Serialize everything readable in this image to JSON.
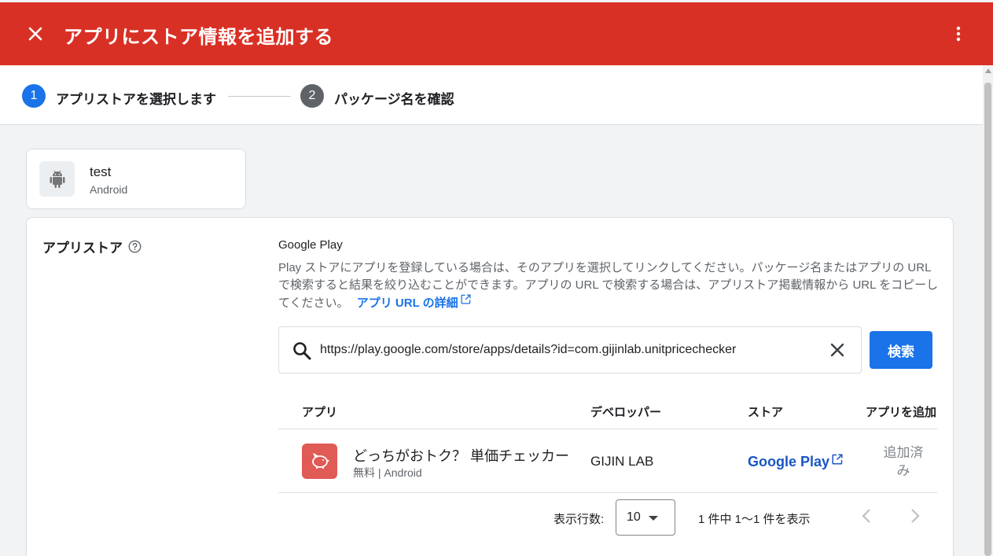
{
  "header": {
    "title": "アプリにストア情報を追加する",
    "bg_color": "#d93025"
  },
  "stepper": {
    "steps": [
      {
        "number": "1",
        "label": "アプリストアを選択します",
        "state": "active"
      },
      {
        "number": "2",
        "label": "パッケージ名を確認",
        "state": "inactive"
      }
    ],
    "active_color": "#1a73e8",
    "inactive_color": "#5f6368"
  },
  "app_card": {
    "name": "test",
    "platform": "Android",
    "icon": "android-icon"
  },
  "store_section": {
    "label": "アプリストア",
    "store_name": "Google Play",
    "description": "Play ストアにアプリを登録している場合は、そのアプリを選択してリンクしてください。パッケージ名またはアプリの URL で検索すると結果を絞り込むことができます。アプリの URL で検索する場合は、アプリストア掲載情報から URL をコピーしてください。",
    "learn_more_link": "アプリ URL の詳細",
    "search_value": "https://play.google.com/store/apps/details?id=com.gijinlab.unitpricechecker",
    "search_button": "検索",
    "accent_color": "#1a73e8"
  },
  "table": {
    "headers": {
      "app": "アプリ",
      "developer": "デベロッパー",
      "store": "ストア",
      "add": "アプリを追加"
    },
    "rows": [
      {
        "app_name": "どっちがおトク？ 単価チェッカー",
        "app_sub": "無料 | Android",
        "developer": "GIJIN LAB",
        "store": "Google Play",
        "status": "追加済み"
      }
    ]
  },
  "pagination": {
    "rows_per_page_label": "表示行数:",
    "rows_per_page": "10",
    "range_text": "1 件中 1〜1 件を表示"
  }
}
